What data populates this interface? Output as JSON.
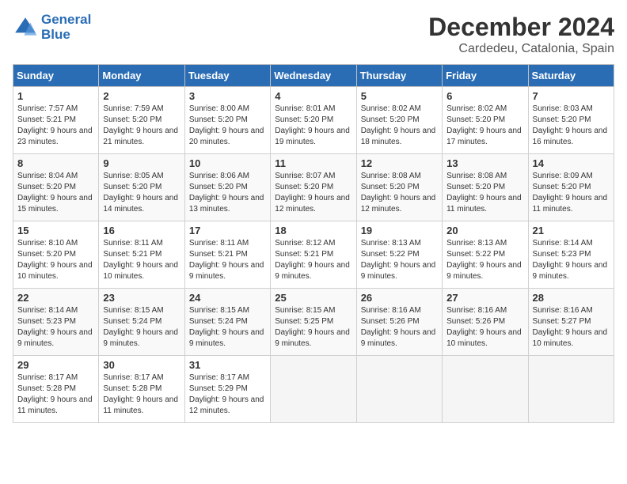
{
  "logo": {
    "line1": "General",
    "line2": "Blue"
  },
  "title": "December 2024",
  "location": "Cardedeu, Catalonia, Spain",
  "days_of_week": [
    "Sunday",
    "Monday",
    "Tuesday",
    "Wednesday",
    "Thursday",
    "Friday",
    "Saturday"
  ],
  "weeks": [
    [
      {
        "day": "1",
        "sunrise": "7:57 AM",
        "sunset": "5:21 PM",
        "daylight": "9 hours and 23 minutes."
      },
      {
        "day": "2",
        "sunrise": "7:59 AM",
        "sunset": "5:20 PM",
        "daylight": "9 hours and 21 minutes."
      },
      {
        "day": "3",
        "sunrise": "8:00 AM",
        "sunset": "5:20 PM",
        "daylight": "9 hours and 20 minutes."
      },
      {
        "day": "4",
        "sunrise": "8:01 AM",
        "sunset": "5:20 PM",
        "daylight": "9 hours and 19 minutes."
      },
      {
        "day": "5",
        "sunrise": "8:02 AM",
        "sunset": "5:20 PM",
        "daylight": "9 hours and 18 minutes."
      },
      {
        "day": "6",
        "sunrise": "8:02 AM",
        "sunset": "5:20 PM",
        "daylight": "9 hours and 17 minutes."
      },
      {
        "day": "7",
        "sunrise": "8:03 AM",
        "sunset": "5:20 PM",
        "daylight": "9 hours and 16 minutes."
      }
    ],
    [
      {
        "day": "8",
        "sunrise": "8:04 AM",
        "sunset": "5:20 PM",
        "daylight": "9 hours and 15 minutes."
      },
      {
        "day": "9",
        "sunrise": "8:05 AM",
        "sunset": "5:20 PM",
        "daylight": "9 hours and 14 minutes."
      },
      {
        "day": "10",
        "sunrise": "8:06 AM",
        "sunset": "5:20 PM",
        "daylight": "9 hours and 13 minutes."
      },
      {
        "day": "11",
        "sunrise": "8:07 AM",
        "sunset": "5:20 PM",
        "daylight": "9 hours and 12 minutes."
      },
      {
        "day": "12",
        "sunrise": "8:08 AM",
        "sunset": "5:20 PM",
        "daylight": "9 hours and 12 minutes."
      },
      {
        "day": "13",
        "sunrise": "8:08 AM",
        "sunset": "5:20 PM",
        "daylight": "9 hours and 11 minutes."
      },
      {
        "day": "14",
        "sunrise": "8:09 AM",
        "sunset": "5:20 PM",
        "daylight": "9 hours and 11 minutes."
      }
    ],
    [
      {
        "day": "15",
        "sunrise": "8:10 AM",
        "sunset": "5:20 PM",
        "daylight": "9 hours and 10 minutes."
      },
      {
        "day": "16",
        "sunrise": "8:11 AM",
        "sunset": "5:21 PM",
        "daylight": "9 hours and 10 minutes."
      },
      {
        "day": "17",
        "sunrise": "8:11 AM",
        "sunset": "5:21 PM",
        "daylight": "9 hours and 9 minutes."
      },
      {
        "day": "18",
        "sunrise": "8:12 AM",
        "sunset": "5:21 PM",
        "daylight": "9 hours and 9 minutes."
      },
      {
        "day": "19",
        "sunrise": "8:13 AM",
        "sunset": "5:22 PM",
        "daylight": "9 hours and 9 minutes."
      },
      {
        "day": "20",
        "sunrise": "8:13 AM",
        "sunset": "5:22 PM",
        "daylight": "9 hours and 9 minutes."
      },
      {
        "day": "21",
        "sunrise": "8:14 AM",
        "sunset": "5:23 PM",
        "daylight": "9 hours and 9 minutes."
      }
    ],
    [
      {
        "day": "22",
        "sunrise": "8:14 AM",
        "sunset": "5:23 PM",
        "daylight": "9 hours and 9 minutes."
      },
      {
        "day": "23",
        "sunrise": "8:15 AM",
        "sunset": "5:24 PM",
        "daylight": "9 hours and 9 minutes."
      },
      {
        "day": "24",
        "sunrise": "8:15 AM",
        "sunset": "5:24 PM",
        "daylight": "9 hours and 9 minutes."
      },
      {
        "day": "25",
        "sunrise": "8:15 AM",
        "sunset": "5:25 PM",
        "daylight": "9 hours and 9 minutes."
      },
      {
        "day": "26",
        "sunrise": "8:16 AM",
        "sunset": "5:26 PM",
        "daylight": "9 hours and 9 minutes."
      },
      {
        "day": "27",
        "sunrise": "8:16 AM",
        "sunset": "5:26 PM",
        "daylight": "9 hours and 10 minutes."
      },
      {
        "day": "28",
        "sunrise": "8:16 AM",
        "sunset": "5:27 PM",
        "daylight": "9 hours and 10 minutes."
      }
    ],
    [
      {
        "day": "29",
        "sunrise": "8:17 AM",
        "sunset": "5:28 PM",
        "daylight": "9 hours and 11 minutes."
      },
      {
        "day": "30",
        "sunrise": "8:17 AM",
        "sunset": "5:28 PM",
        "daylight": "9 hours and 11 minutes."
      },
      {
        "day": "31",
        "sunrise": "8:17 AM",
        "sunset": "5:29 PM",
        "daylight": "9 hours and 12 minutes."
      },
      null,
      null,
      null,
      null
    ]
  ]
}
